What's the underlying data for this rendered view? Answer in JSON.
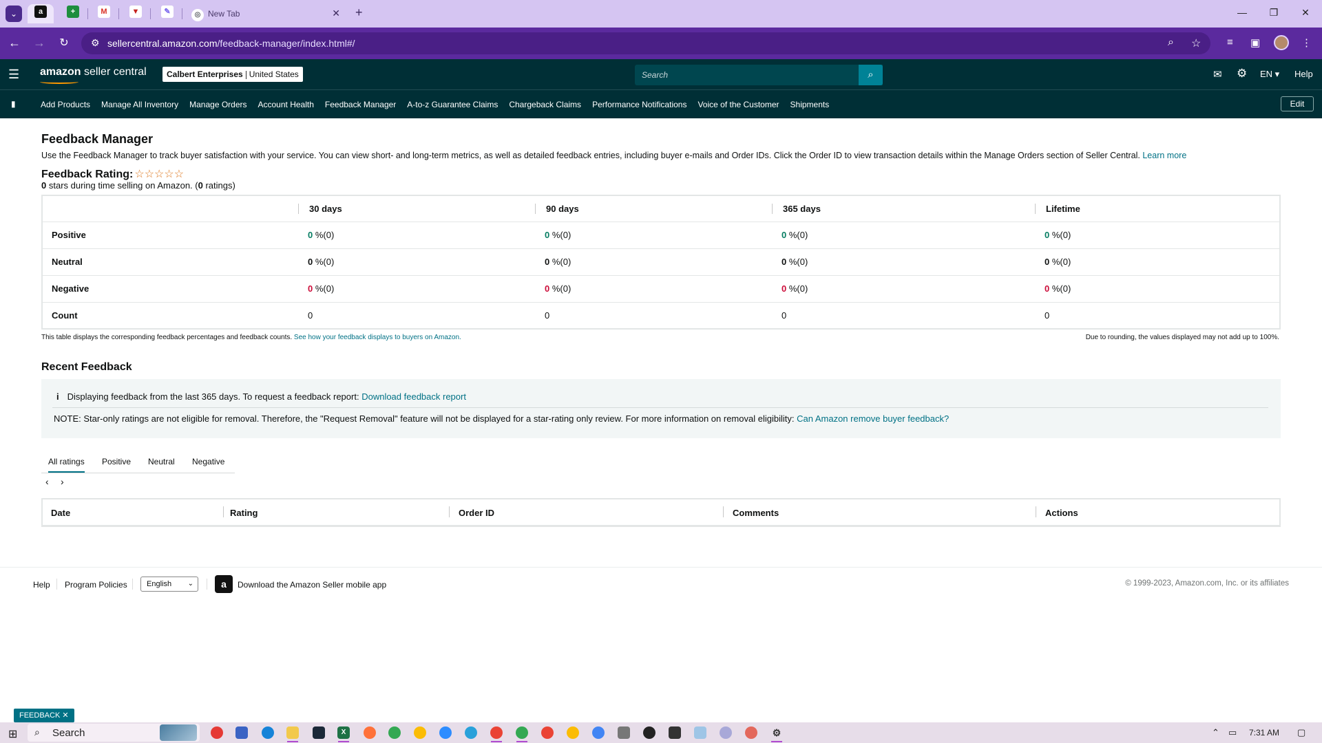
{
  "browser": {
    "active_tab_icon": "amazon-icon",
    "tabs": [
      {
        "icon": "sheets-icon"
      },
      {
        "icon": "gmail-icon"
      },
      {
        "icon": "shield-icon"
      },
      {
        "icon": "clickup-icon"
      }
    ],
    "new_tab_title": "New Tab",
    "url_domain": "sellercentral.amazon.com",
    "url_path": "/feedback-manager/index.html#/"
  },
  "header": {
    "logo_brand": "amazon",
    "logo_product": "seller central",
    "store_name": "Calbert Enterprises",
    "store_region": "United States",
    "search_placeholder": "Search",
    "language": "EN",
    "help": "Help"
  },
  "nav": {
    "links": [
      "Add Products",
      "Manage All Inventory",
      "Manage Orders",
      "Account Health",
      "Feedback Manager",
      "A-to-z Guarantee Claims",
      "Chargeback Claims",
      "Performance Notifications",
      "Voice of the Customer",
      "Shipments"
    ],
    "edit": "Edit"
  },
  "page": {
    "title": "Feedback Manager",
    "intro": "Use the Feedback Manager to track buyer satisfaction with your service. You can view short- and long-term metrics, as well as detailed feedback entries, including buyer e-mails and Order IDs. Click the Order ID to view transaction details within the Manage Orders section of Seller Central.",
    "learn_more": "Learn more",
    "rating_label": "Feedback Rating:",
    "stars": "☆☆☆☆☆",
    "rating_value": "0",
    "rating_mid": " stars during time selling on Amazon. (",
    "rating_count": "0",
    "rating_end": " ratings)"
  },
  "feedback_table": {
    "columns": [
      "30 days",
      "90 days",
      "365 days",
      "Lifetime"
    ],
    "rows": [
      {
        "label": "Positive",
        "values": [
          {
            "num": "0",
            "rest": " %(0)"
          },
          {
            "num": "0",
            "rest": " %(0)"
          },
          {
            "num": "0",
            "rest": " %(0)"
          },
          {
            "num": "0",
            "rest": " %(0)"
          }
        ]
      },
      {
        "label": "Neutral",
        "values": [
          {
            "num": "0",
            "rest": " %(0)"
          },
          {
            "num": "0",
            "rest": " %(0)"
          },
          {
            "num": "0",
            "rest": " %(0)"
          },
          {
            "num": "0",
            "rest": " %(0)"
          }
        ]
      },
      {
        "label": "Negative",
        "values": [
          {
            "num": "0",
            "rest": " %(0)"
          },
          {
            "num": "0",
            "rest": " %(0)"
          },
          {
            "num": "0",
            "rest": " %(0)"
          },
          {
            "num": "0",
            "rest": " %(0)"
          }
        ]
      },
      {
        "label": "Count",
        "values": [
          "0",
          "0",
          "0",
          "0"
        ]
      }
    ],
    "footnote": "This table displays the corresponding feedback percentages and feedback counts.",
    "footnote_link": "See how your feedback displays to buyers on Amazon.",
    "rounding_note": "Due to rounding, the values displayed may not add up to 100%."
  },
  "recent": {
    "title": "Recent Feedback",
    "info_icon": "i",
    "info_text": "Displaying feedback from the last 365 days. To request a feedback report:",
    "info_link": "Download feedback report",
    "note_text": "NOTE: Star-only ratings are not eligible for removal. Therefore, the \"Request Removal\" feature will not be displayed for a star-rating only review. For more information on removal eligibility:",
    "note_link": "Can Amazon remove buyer feedback?",
    "tabs": [
      "All ratings",
      "Positive",
      "Neutral",
      "Negative"
    ],
    "columns": [
      "Date",
      "Rating",
      "Order ID",
      "Comments",
      "Actions"
    ]
  },
  "footer": {
    "help": "Help",
    "policies": "Program Policies",
    "language": "English",
    "app_text": "Download the Amazon Seller mobile app",
    "copyright": "© 1999-2023, Amazon.com, Inc. or its affiliates"
  },
  "feedback_tab": "FEEDBACK",
  "taskbar": {
    "search": "Search",
    "time": "7:31 AM"
  },
  "colors": {
    "header_bg": "#002f36",
    "browser_toolbar": "#5b2a9e",
    "link": "#007185",
    "positive": "#067d62",
    "negative": "#cc0c39",
    "star": "#de7921"
  }
}
